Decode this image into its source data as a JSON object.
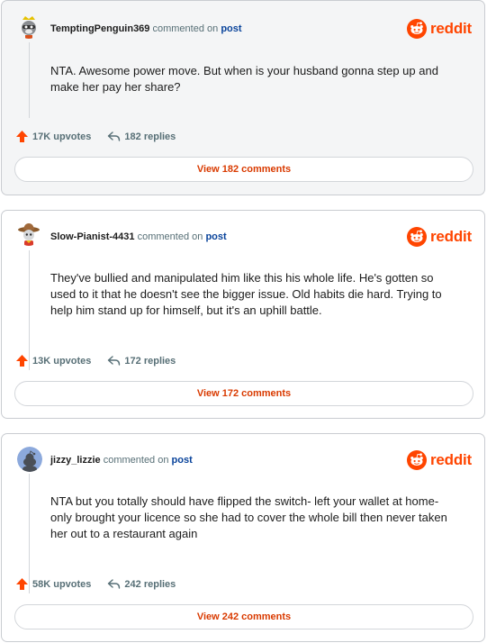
{
  "brand": {
    "logo_text": "reddit",
    "accent": "#ff4500",
    "link_color": "#0a449b",
    "cta_color": "#d93a00"
  },
  "comments": [
    {
      "username": "TemptingPenguin369",
      "action_text": "commented on",
      "post_link": "post",
      "avatar_icon": "snoo-raccoon-avatar-icon",
      "body": "NTA. Awesome power move. But when is your husband gonna step up and make her pay her share?",
      "upvotes": "17K upvotes",
      "replies": "182 replies",
      "view_button": "View 182 comments"
    },
    {
      "username": "Slow-Pianist-4431",
      "action_text": "commented on",
      "post_link": "post",
      "avatar_icon": "snoo-cowboy-avatar-icon",
      "body": "They've bullied and manipulated him like this his whole life. He's gotten so used to it that he doesn't see the bigger issue. Old habits die hard. Trying to help him stand up for himself, but it's an uphill battle.",
      "upvotes": "13K upvotes",
      "replies": "172 replies",
      "view_button": "View 172 comments"
    },
    {
      "username": "jizzy_lizzie",
      "action_text": "commented on",
      "post_link": "post",
      "avatar_icon": "default-snoo-avatar-icon",
      "body": "NTA but you totally should have flipped the switch- left your wallet at home- only brought your licence so she had to cover the whole bill then never taken her out to a restaurant again",
      "upvotes": "58K upvotes",
      "replies": "242 replies",
      "view_button": "View 242 comments"
    }
  ]
}
